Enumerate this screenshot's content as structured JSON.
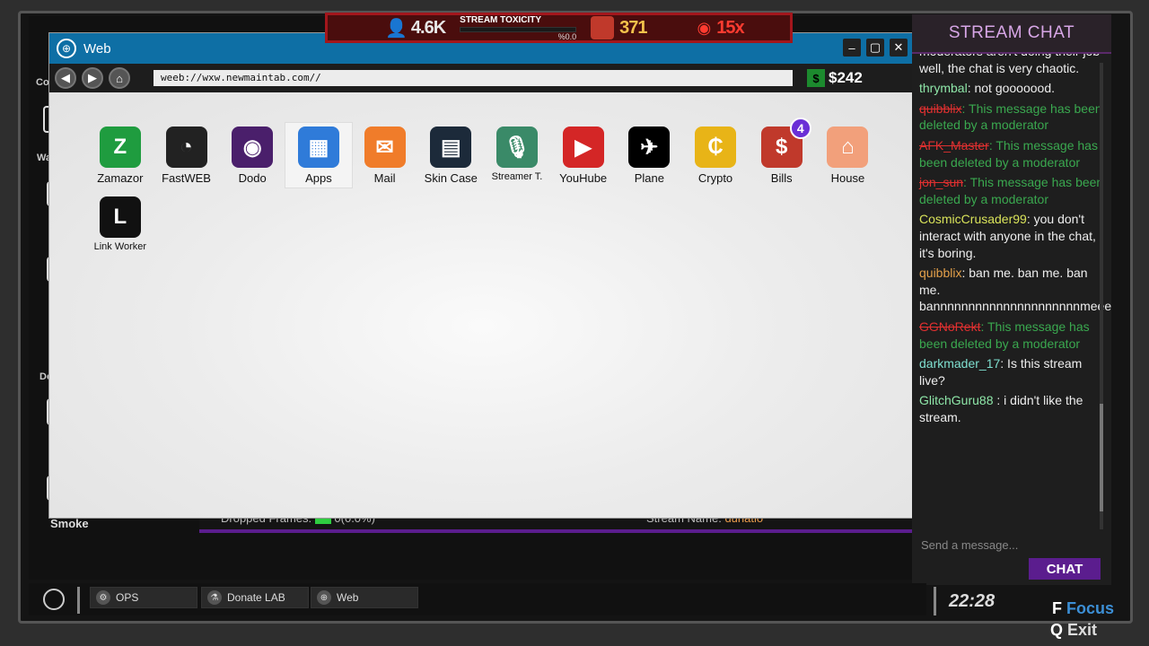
{
  "hud": {
    "viewers": "4.6K",
    "toxicity_label": "STREAM TOXICITY",
    "toxicity_pct": "%0.0",
    "fist_count": "371",
    "multiplier": "15x"
  },
  "window": {
    "title": "Web",
    "url": "weeb://wxw.newmaintab.com//",
    "balance": "$242",
    "balance_icon": "$"
  },
  "apps": [
    {
      "label": "Zamazor",
      "glyph": "Z",
      "color": "#1f9c3f"
    },
    {
      "label": "FastWEB",
      "glyph": "◔",
      "color": "#222222"
    },
    {
      "label": "Dodo",
      "glyph": "◉",
      "color": "#4a1f6b"
    },
    {
      "label": "Apps",
      "glyph": "▦",
      "color": "#2f7bd9"
    },
    {
      "label": "Mail",
      "glyph": "✉",
      "color": "#f07c2a"
    },
    {
      "label": "Skin Case",
      "glyph": "▤",
      "color": "#1c2a3a"
    },
    {
      "label": "Streamer T.",
      "glyph": "🎙",
      "color": "#3a8a68"
    },
    {
      "label": "YouHube",
      "glyph": "▶",
      "color": "#d42626"
    },
    {
      "label": "Plane",
      "glyph": "✈",
      "color": "#000000"
    },
    {
      "label": "Crypto",
      "glyph": "₵",
      "color": "#e8b417"
    },
    {
      "label": "Bills",
      "glyph": "$",
      "color": "#c0392b",
      "badge": "4"
    },
    {
      "label": "House",
      "glyph": "⌂",
      "color": "#f2a07b"
    },
    {
      "label": "Link Worker",
      "glyph": "L",
      "color": "#111111"
    }
  ],
  "stats": {
    "dropped_frames_label": "Dropped Frames:",
    "dropped_frames_value": "0(0.0%)",
    "stream_name_label": "Stream Name:",
    "stream_name_value": "dunatio"
  },
  "desktop": {
    "smoke_label": "Smoke",
    "side_labels": [
      "Co",
      "Wa",
      "Do"
    ]
  },
  "chat": {
    "title": "STREAM CHAT",
    "top_fragment": "moderators aren't doing their job well, the chat is very chaotic.",
    "messages": [
      {
        "user": "thrymbal",
        "text": ": not gooooood.",
        "color": "#8ee6a8"
      },
      {
        "user": "quibblix",
        "text": ": This message has been deleted by a moderator",
        "deleted": true
      },
      {
        "user": "AFK_Master",
        "text": ": This message has been deleted by a moderator",
        "deleted": true
      },
      {
        "user": "jon_sun",
        "text": ": This message has been deleted by a moderator",
        "deleted": true
      },
      {
        "user": "CosmicCrusader99",
        "text": ": you don't interact with anyone in the chat, it's boring.",
        "color": "#d9e35a"
      },
      {
        "user": "quibblix",
        "text": ": ban me. ban me. ban me. bannnnnnnnnnnnnnnnnnnnnmeeeeeeee.",
        "color": "#e3a04a"
      },
      {
        "user": "GGNoRekt",
        "text": ": This message has been deleted by a moderator",
        "deleted": true
      },
      {
        "user": "darkmader_17",
        "text": ": Is this stream live?",
        "color": "#7fe0d0"
      },
      {
        "user": "GlitchGuru88",
        "text": " : i didn't like the stream.",
        "color": "#8ee6a8"
      }
    ],
    "input_placeholder": "Send a message...",
    "send_label": "CHAT"
  },
  "taskbar": {
    "items": [
      "OPS",
      "Donate LAB",
      "Web"
    ],
    "clock": "22:28"
  },
  "hints": {
    "focus_key": "F",
    "focus_label": "Focus",
    "exit_key": "Q",
    "exit_label": "Exit"
  }
}
